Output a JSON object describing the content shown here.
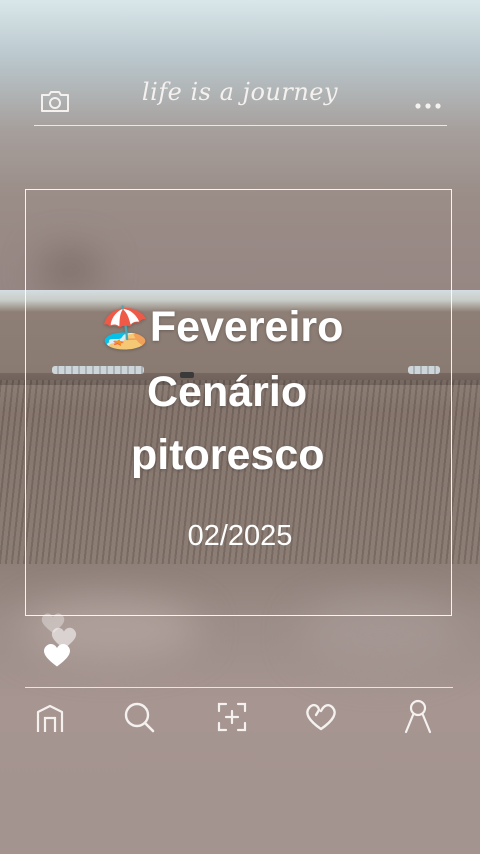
{
  "header": {
    "camera_icon": "camera-icon",
    "title": "life is a journey",
    "more_icon": "more-dots-icon"
  },
  "card": {
    "emoji": "🏖️",
    "title_line1": "Fevereiro",
    "title_line2": "Cenário",
    "title_line3": "pitoresco",
    "date": "02/2025"
  },
  "reactions": {
    "icon": "heart-icon"
  },
  "nav": {
    "items": [
      {
        "name": "home",
        "icon": "home-icon"
      },
      {
        "name": "search",
        "icon": "search-icon"
      },
      {
        "name": "add",
        "icon": "add-frame-icon"
      },
      {
        "name": "favorites",
        "icon": "heart-outline-icon"
      },
      {
        "name": "profile",
        "icon": "profile-icon"
      }
    ]
  },
  "colors": {
    "line": "#ffffff",
    "text": "#ffffff"
  }
}
